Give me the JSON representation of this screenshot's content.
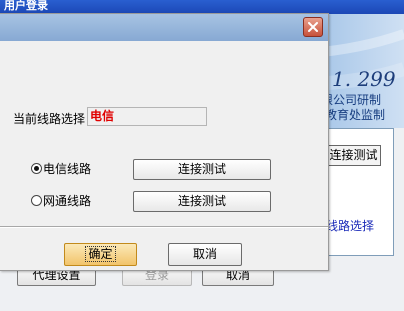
{
  "background_window": {
    "title": "用户登录",
    "version": "1. 299",
    "developer": "限公司研制",
    "supervisor": "教育处监制",
    "test_button": "连接测试",
    "line_select_link": "线路选择",
    "buttons": {
      "proxy": "代理设置",
      "login": "登录",
      "cancel": "取消"
    }
  },
  "dialog": {
    "close_icon": "close-icon",
    "current_line_label": "当前线路选择",
    "current_line_value": "电信",
    "options": [
      {
        "label": "电信线路",
        "checked": true,
        "test_label": "连接测试"
      },
      {
        "label": "网通线路",
        "checked": false,
        "test_label": "连接测试"
      }
    ],
    "ok_label": "确定",
    "cancel_label": "取消"
  },
  "colors": {
    "value_text": "#e00000",
    "close_button": "#c7513a",
    "ok_button": "#f2c46b"
  }
}
